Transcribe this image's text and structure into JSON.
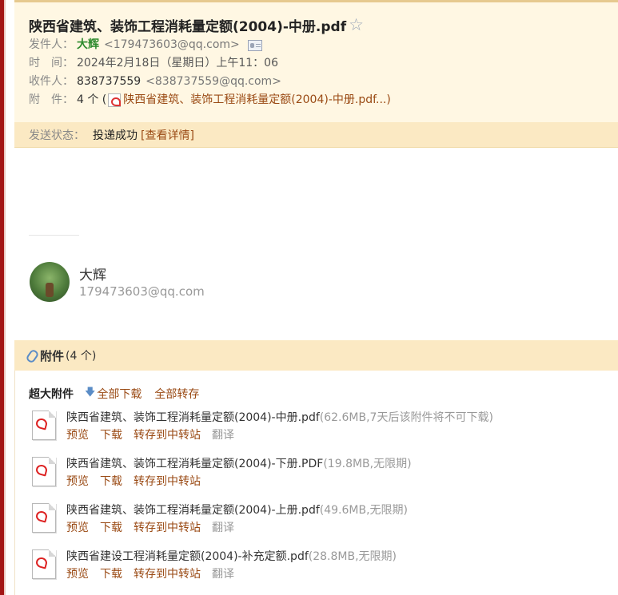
{
  "email": {
    "subject": "陕西省建筑、装饰工程消耗量定额(2004)-中册.pdf",
    "star": "☆",
    "from_label": "发件人：",
    "from_name": "大辉",
    "from_email": "<179473603@qq.com>",
    "time_label": "时　间：",
    "time_value": "2024年2月18日（星期日）上午11：06",
    "to_label": "收件人：",
    "to_name": "838737559",
    "to_email": "<838737559@qq.com>",
    "att_label": "附　件：",
    "att_count": "4 个 (",
    "att_link": "陕西省建筑、装饰工程消耗量定额(2004)-中册.pdf...)",
    "status_label": "发送状态：",
    "status_value": "投递成功",
    "status_link": "[查看详情]"
  },
  "signature": {
    "name": "大辉",
    "email": "179473603@qq.com"
  },
  "attachments": {
    "title": "附件",
    "count": "(4 个)",
    "big_label": "超大附件",
    "download_all": "全部下载",
    "save_all": "全部转存",
    "files": [
      {
        "name": "陕西省建筑、装饰工程消耗量定额(2004)-中册.pdf",
        "meta": "(62.6MB,7天后该附件将不可下载)",
        "preview": "预览",
        "download": "下载",
        "transfer": "转存到中转站",
        "translate": "翻译"
      },
      {
        "name": "陕西省建筑、装饰工程消耗量定额(2004)-下册.PDF",
        "meta": "(19.8MB,无限期)",
        "preview": "预览",
        "download": "下载",
        "transfer": "转存到中转站",
        "translate": ""
      },
      {
        "name": "陕西省建筑、装饰工程消耗量定额(2004)-上册.pdf",
        "meta": "(49.6MB,无限期)",
        "preview": "预览",
        "download": "下载",
        "transfer": "转存到中转站",
        "translate": "翻译"
      },
      {
        "name": "陕西省建设工程消耗量定额(2004)-补充定额.pdf",
        "meta": "(28.8MB,无限期)",
        "preview": "预览",
        "download": "下载",
        "transfer": "转存到中转站",
        "translate": "翻译"
      }
    ]
  },
  "colors": {
    "header_bg": "#fff7e3",
    "status_bg": "#fbe9c3",
    "link": "#9a4a14",
    "sender": "#2d8a2d",
    "accent_border": "#a31515"
  }
}
